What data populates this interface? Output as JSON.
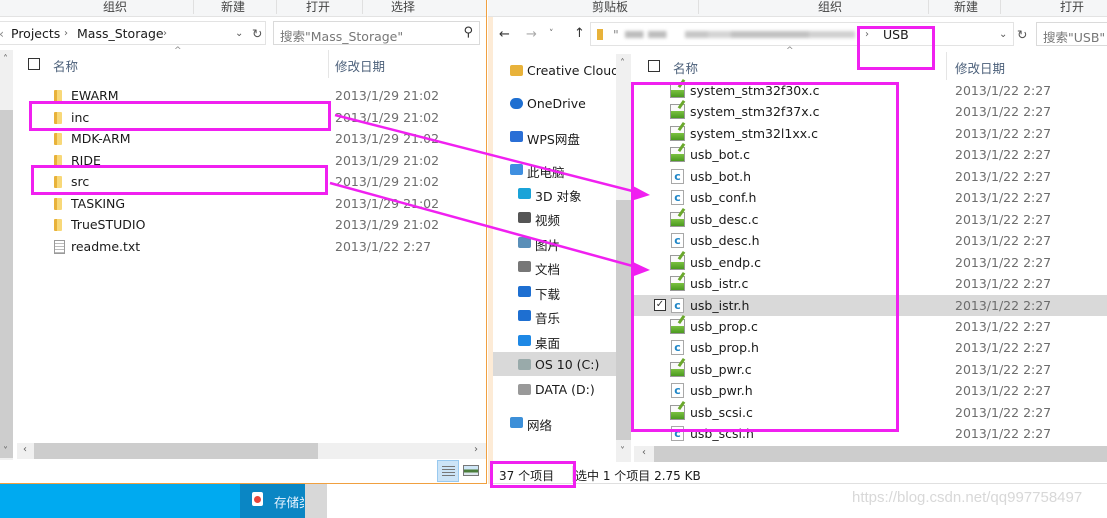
{
  "left_window": {
    "ribbon_groups": [
      "组织",
      "新建",
      "打开",
      "选择"
    ],
    "breadcrumb": [
      "Projects",
      "Mass_Storage"
    ],
    "search_placeholder": "搜索\"Mass_Storage\"",
    "columns": {
      "name": "名称",
      "modified": "修改日期"
    },
    "items": [
      {
        "name": "EWARM",
        "type": "folder",
        "modified": "2013/1/29 21:02"
      },
      {
        "name": "inc",
        "type": "folder",
        "modified": "2013/1/29 21:02",
        "highlighted": true
      },
      {
        "name": "MDK-ARM",
        "type": "folder",
        "modified": "2013/1/29 21:02"
      },
      {
        "name": "RIDE",
        "type": "folder",
        "modified": "2013/1/29 21:02"
      },
      {
        "name": "src",
        "type": "folder",
        "modified": "2013/1/29 21:02",
        "highlighted": true
      },
      {
        "name": "TASKING",
        "type": "folder",
        "modified": "2013/1/29 21:02"
      },
      {
        "name": "TrueSTUDIO",
        "type": "folder",
        "modified": "2013/1/29 21:02"
      },
      {
        "name": "readme.txt",
        "type": "text",
        "modified": "2013/1/22 2:27"
      }
    ]
  },
  "right_window": {
    "ribbon_groups": [
      "剪贴板",
      "组织",
      "新建",
      "打开"
    ],
    "breadcrumb_current": "USB",
    "breadcrumb_prefix_blurred": "\"",
    "search_placeholder": "搜索\"USB\"",
    "columns": {
      "name": "名称",
      "modified": "修改日期"
    },
    "nav_pane": [
      {
        "label": "Creative Cloud",
        "icon": "creative-cloud-icon"
      },
      {
        "label": "OneDrive",
        "icon": "onedrive-icon"
      },
      {
        "label": "WPS网盘",
        "icon": "wps-cloud-icon"
      },
      {
        "label": "此电脑",
        "icon": "computer-icon"
      },
      {
        "label": "3D 对象",
        "icon": "3d-objects-icon"
      },
      {
        "label": "视频",
        "icon": "video-icon"
      },
      {
        "label": "图片",
        "icon": "pictures-icon"
      },
      {
        "label": "文档",
        "icon": "documents-icon"
      },
      {
        "label": "下载",
        "icon": "download-icon"
      },
      {
        "label": "音乐",
        "icon": "music-icon"
      },
      {
        "label": "桌面",
        "icon": "desktop-icon"
      },
      {
        "label": "OS 10 (C:)",
        "icon": "drive-c-icon",
        "selected": true
      },
      {
        "label": "DATA (D:)",
        "icon": "drive-d-icon"
      },
      {
        "label": "网络",
        "icon": "network-icon"
      }
    ],
    "files": [
      {
        "name": "system_stm32f30x.c",
        "type": "c-source",
        "modified": "2013/1/22 2:27"
      },
      {
        "name": "system_stm32f37x.c",
        "type": "c-source",
        "modified": "2013/1/22 2:27"
      },
      {
        "name": "system_stm32l1xx.c",
        "type": "c-source",
        "modified": "2013/1/22 2:27"
      },
      {
        "name": "usb_bot.c",
        "type": "c-source",
        "modified": "2013/1/22 2:27"
      },
      {
        "name": "usb_bot.h",
        "type": "c-header",
        "modified": "2013/1/22 2:27"
      },
      {
        "name": "usb_conf.h",
        "type": "c-header",
        "modified": "2013/1/22 2:27"
      },
      {
        "name": "usb_desc.c",
        "type": "c-source",
        "modified": "2013/1/22 2:27"
      },
      {
        "name": "usb_desc.h",
        "type": "c-header",
        "modified": "2013/1/22 2:27"
      },
      {
        "name": "usb_endp.c",
        "type": "c-source",
        "modified": "2013/1/22 2:27"
      },
      {
        "name": "usb_istr.c",
        "type": "c-source",
        "modified": "2013/1/22 2:27"
      },
      {
        "name": "usb_istr.h",
        "type": "c-header",
        "modified": "2013/1/22 2:27",
        "selected": true
      },
      {
        "name": "usb_prop.c",
        "type": "c-source",
        "modified": "2013/1/22 2:27"
      },
      {
        "name": "usb_prop.h",
        "type": "c-header",
        "modified": "2013/1/22 2:27"
      },
      {
        "name": "usb_pwr.c",
        "type": "c-source",
        "modified": "2013/1/22 2:27"
      },
      {
        "name": "usb_pwr.h",
        "type": "c-header",
        "modified": "2013/1/22 2:27"
      },
      {
        "name": "usb_scsi.c",
        "type": "c-source",
        "modified": "2013/1/22 2:27"
      },
      {
        "name": "usb_scsi.h",
        "type": "c-header",
        "modified": "2013/1/22 2:27"
      }
    ],
    "status": {
      "item_count": "37 个项目",
      "selection": "选中 1 个项目  2.75 KB"
    }
  },
  "taskbar": {
    "item_label": "存储类"
  },
  "watermark": "https://blog.csdn.net/qq997758497",
  "colors": {
    "annotation": "#f020f0",
    "window_border": "#f0a040",
    "taskbar": "#00aaf0",
    "selected_row": "#d9d9d9"
  }
}
